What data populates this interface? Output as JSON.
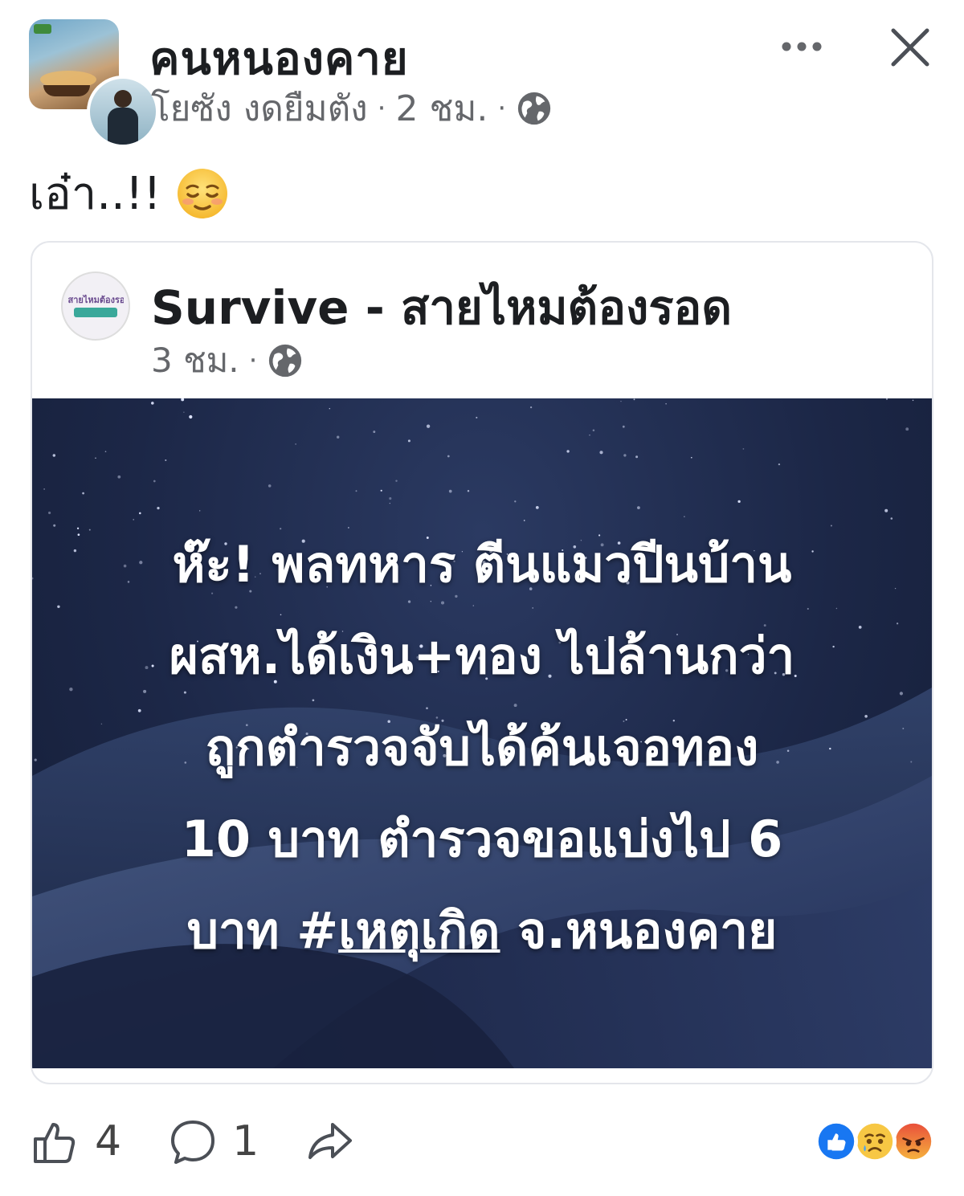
{
  "header": {
    "group_name": "คนหนองคาย",
    "author": "โยซัง งดยืมตัง",
    "time": "2 ชม.",
    "separator": "·",
    "privacy_icon": "globe-icon",
    "more_icon": "more-dots-icon",
    "close_icon": "close-icon"
  },
  "post": {
    "text": "เอ๋า..!!",
    "emoji": "relieved-face-emoji"
  },
  "shared": {
    "page_name": "Survive - สายไหมต้องรอด",
    "time": "3 ชม.",
    "separator": "·",
    "privacy_icon": "globe-icon",
    "avatar_text": "#สายไหมต้องรอด",
    "headline_lines": [
      "ห๊ะ! พลทหาร ตีนแมวปีนบ้าน",
      "ผสห.ได้เงิน+ทอง ไปล้านกว่า",
      "ถูกตำรวจจับได้ค้นเจอทอง",
      "10 บาท ตำรวจขอแบ่งไป 6"
    ],
    "headline_last": {
      "prefix": "บาท #",
      "hashtag": "เหตุเกิด",
      "suffix": " จ.หนองคาย"
    }
  },
  "actions": {
    "like_count": "4",
    "comment_count": "1",
    "like_icon": "thumbs-up-icon",
    "comment_icon": "comment-icon",
    "share_icon": "share-icon",
    "reactions": [
      "like",
      "sad",
      "angry"
    ]
  },
  "colors": {
    "text_primary": "#1c1e21",
    "text_secondary": "#65676b",
    "like_blue": "#1877f2",
    "image_bg": "#1c2747"
  }
}
